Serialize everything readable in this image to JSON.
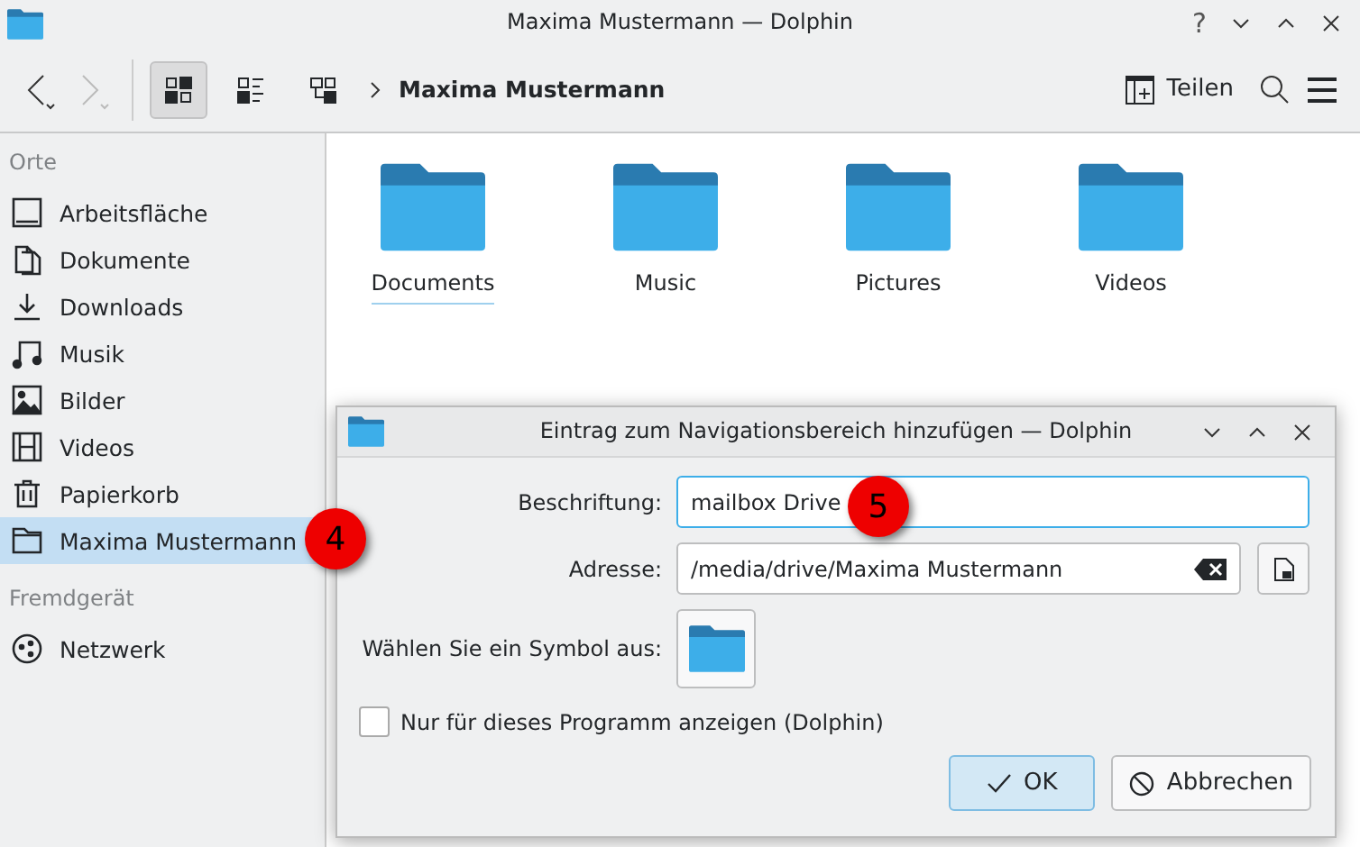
{
  "window": {
    "title": "Maxima Mustermann — Dolphin",
    "controls": [
      "?"
    ]
  },
  "toolbar": {
    "view_modes": [
      {
        "kind": "icons",
        "selected": true
      },
      {
        "kind": "details",
        "selected": false
      },
      {
        "kind": "tree",
        "selected": false
      }
    ],
    "breadcrumb": "Maxima Mustermann",
    "share": "Teilen"
  },
  "sidebar": {
    "sections": [
      {
        "title": "Orte",
        "items": [
          {
            "label": "Arbeitsfläche",
            "kind": "desktop",
            "selected": false
          },
          {
            "label": "Dokumente",
            "kind": "documents",
            "selected": false
          },
          {
            "label": "Downloads",
            "kind": "downloads",
            "selected": false
          },
          {
            "label": "Musik",
            "kind": "music",
            "selected": false
          },
          {
            "label": "Bilder",
            "kind": "pictures",
            "selected": false
          },
          {
            "label": "Videos",
            "kind": "videos",
            "selected": false
          },
          {
            "label": "Papierkorb",
            "kind": "trash",
            "selected": false
          },
          {
            "label": "Maxima Mustermann",
            "kind": "folder",
            "selected": true
          }
        ]
      },
      {
        "title": "Fremdgerät",
        "items": [
          {
            "label": "Netzwerk",
            "kind": "network",
            "selected": false
          }
        ]
      }
    ]
  },
  "folders": [
    {
      "name": "Documents",
      "focused": true
    },
    {
      "name": "Music",
      "focused": false
    },
    {
      "name": "Pictures",
      "focused": false
    },
    {
      "name": "Videos",
      "focused": false
    }
  ],
  "dialog": {
    "title": "Eintrag zum Navigationsbereich hinzufügen — Dolphin",
    "label_field": {
      "label": "Beschriftung:",
      "value": "mailbox Drive"
    },
    "address_field": {
      "label": "Adresse:",
      "value": "/media/drive/Maxima Mustermann"
    },
    "icon_label": "Wählen Sie ein Symbol aus:",
    "checkbox": {
      "label": "Nur für dieses Programm anzeigen (Dolphin)",
      "checked": false
    },
    "buttons": [
      {
        "label": "OK",
        "kind": "ok"
      },
      {
        "label": "Abbrechen",
        "kind": "cancel"
      }
    ]
  },
  "callouts": [
    {
      "number": "4",
      "kind": "sidebar"
    },
    {
      "number": "5",
      "kind": "field"
    }
  ]
}
